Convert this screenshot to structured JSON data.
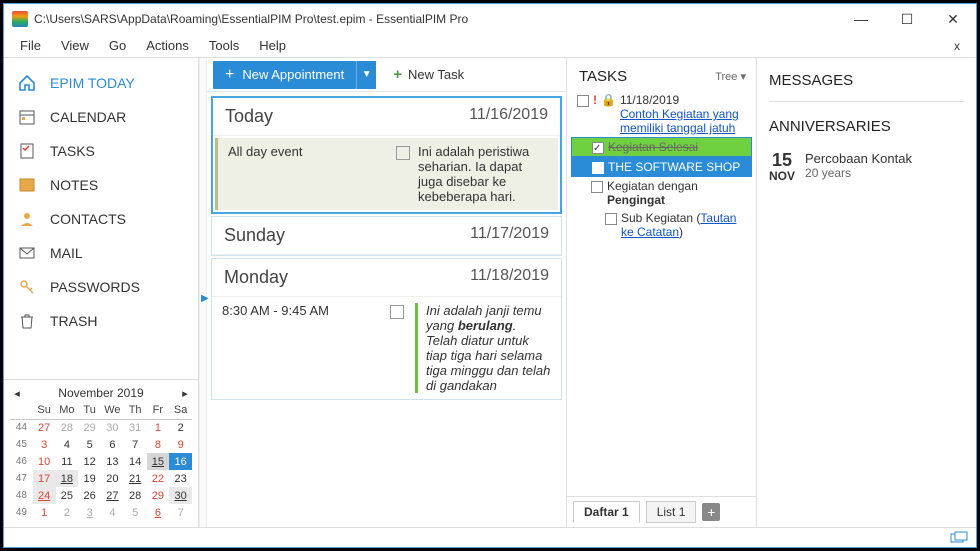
{
  "window": {
    "title": "C:\\Users\\SARS\\AppData\\Roaming\\EssentialPIM Pro\\test.epim - EssentialPIM Pro"
  },
  "menu": {
    "items": [
      "File",
      "View",
      "Go",
      "Actions",
      "Tools",
      "Help"
    ],
    "close": "x"
  },
  "toolbar": {
    "new_appointment": "New Appointment",
    "new_task": "New Task"
  },
  "sidebar": {
    "items": [
      {
        "label": "EPIM TODAY",
        "active": true,
        "icon": "home"
      },
      {
        "label": "CALENDAR",
        "active": false,
        "icon": "calendar"
      },
      {
        "label": "TASKS",
        "active": false,
        "icon": "tasks"
      },
      {
        "label": "NOTES",
        "active": false,
        "icon": "notes"
      },
      {
        "label": "CONTACTS",
        "active": false,
        "icon": "contacts"
      },
      {
        "label": "MAIL",
        "active": false,
        "icon": "mail"
      },
      {
        "label": "PASSWORDS",
        "active": false,
        "icon": "passwords"
      },
      {
        "label": "TRASH",
        "active": false,
        "icon": "trash"
      }
    ]
  },
  "mini_calendar": {
    "month": "November  2019",
    "weekdays": [
      "Su",
      "Mo",
      "Tu",
      "We",
      "Th",
      "Fr",
      "Sa"
    ],
    "weeks": [
      {
        "wk": "44",
        "days": [
          {
            "d": "27",
            "dim": true,
            "red": true
          },
          {
            "d": "28",
            "dim": true
          },
          {
            "d": "29",
            "dim": true
          },
          {
            "d": "30",
            "dim": true
          },
          {
            "d": "31",
            "dim": true
          },
          {
            "d": "1",
            "red": true
          },
          {
            "d": "2"
          }
        ]
      },
      {
        "wk": "45",
        "days": [
          {
            "d": "3",
            "red": true
          },
          {
            "d": "4"
          },
          {
            "d": "5"
          },
          {
            "d": "6"
          },
          {
            "d": "7"
          },
          {
            "d": "8",
            "red": true
          },
          {
            "d": "9",
            "red": true
          }
        ]
      },
      {
        "wk": "46",
        "days": [
          {
            "d": "10",
            "red": true
          },
          {
            "d": "11"
          },
          {
            "d": "12"
          },
          {
            "d": "13"
          },
          {
            "d": "14"
          },
          {
            "d": "15",
            "today": true,
            "ul": true
          },
          {
            "d": "16",
            "sel": true
          }
        ]
      },
      {
        "wk": "47",
        "days": [
          {
            "d": "17",
            "red": true,
            "box": true
          },
          {
            "d": "18",
            "box": true,
            "ul": true
          },
          {
            "d": "19"
          },
          {
            "d": "20"
          },
          {
            "d": "21",
            "ul": true
          },
          {
            "d": "22",
            "red": true
          },
          {
            "d": "23"
          }
        ]
      },
      {
        "wk": "48",
        "days": [
          {
            "d": "24",
            "red": true,
            "box": true,
            "ul": true
          },
          {
            "d": "25"
          },
          {
            "d": "26"
          },
          {
            "d": "27",
            "ul": true
          },
          {
            "d": "28"
          },
          {
            "d": "29",
            "red": true
          },
          {
            "d": "30",
            "box": true,
            "ul": true
          }
        ]
      },
      {
        "wk": "49",
        "days": [
          {
            "d": "1",
            "dim": true,
            "red": true
          },
          {
            "d": "2",
            "dim": true
          },
          {
            "d": "3",
            "dim": true,
            "ul": true
          },
          {
            "d": "4",
            "dim": true
          },
          {
            "d": "5",
            "dim": true
          },
          {
            "d": "6",
            "dim": true,
            "red": true,
            "ul": true
          },
          {
            "d": "7",
            "dim": true
          }
        ]
      }
    ]
  },
  "days": {
    "today": {
      "title": "Today",
      "date": "11/16/2019",
      "allday_label": "All day event",
      "allday_desc": "Ini adalah peristiwa seharian. Ia dapat juga disebar ke kebeberapa hari."
    },
    "sunday": {
      "title": "Sunday",
      "date": "11/17/2019"
    },
    "monday": {
      "title": "Monday",
      "date": "11/18/2019",
      "time": "8:30 AM - 9:45 AM",
      "desc_pre": "Ini adalah janji temu yang ",
      "desc_b": "berulang",
      "desc_post": ". Telah diatur untuk tiap tiga hari selama tiga minggu dan telah di gandakan"
    }
  },
  "tasks": {
    "heading": "TASKS",
    "mode": "Tree ▾",
    "due": "11/18/2019",
    "link1": "Contoh Kegiatan yang memiliki tanggal jatuh",
    "done": "Kegiatan Selesai",
    "sw": "THE SOFTWARE SHOP",
    "reminder_a": "Kegiatan dengan",
    "reminder_b": "Pengingat",
    "sub_a": "Sub Kegiatan (",
    "sub_link": "Tautan ke Catatan",
    "sub_b": ")",
    "tab1": "Daftar 1",
    "tab2": "List 1"
  },
  "right": {
    "messages": "MESSAGES",
    "anniversaries": "ANNIVERSARIES",
    "anniv_day": "15",
    "anniv_mon": "NOV",
    "anniv_name": "Percobaan Kontak",
    "anniv_sub": "20 years"
  }
}
